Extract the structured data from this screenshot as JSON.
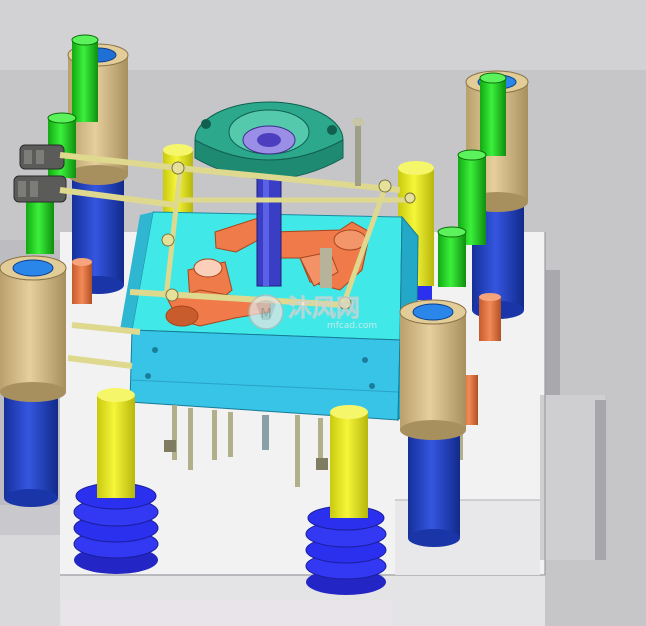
{
  "viewport": {
    "name": "cad-3d-viewport",
    "background": "#c6c6c9",
    "colors": {
      "base_top": "#f4f4f5",
      "base_front": "#e1e1e4",
      "base_side": "#b7b7bb",
      "mold_top": "#3fe8e6",
      "mold_front": "#37c3e6",
      "mold_side": "#21a8c6",
      "part_orange": "#f07a49",
      "sprue_green": "#2aa88b",
      "guide_post_blue": "#1f3fc4",
      "guide_bushing_tan": "#d8bd86",
      "cap_screw_green": "#1fd51f",
      "pillar_yellow": "#e7e71d",
      "spring_blue": "#2a30ee",
      "pin_gray": "#9f9f87"
    },
    "icons": [
      "watermark-logo-icon"
    ]
  },
  "watermark": {
    "text": "沐风网",
    "url": "mfcad.com"
  }
}
